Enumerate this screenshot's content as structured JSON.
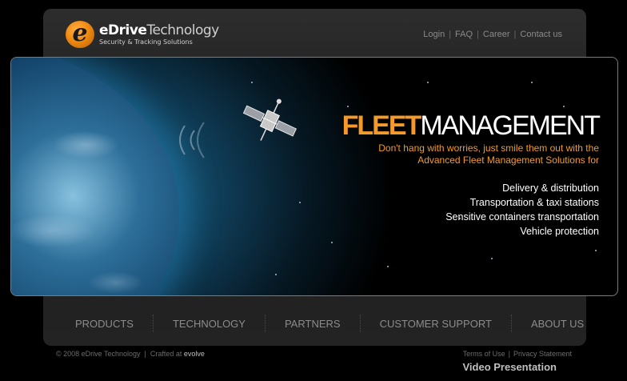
{
  "brand": {
    "logo_letter": "e",
    "name_bold": "eDrive",
    "name_rest": "Technology",
    "tagline": "Security & Tracking Solutions",
    "accent_color": "#f39a28"
  },
  "topnav": {
    "items": [
      "Login",
      "FAQ",
      "Career",
      "Contact us"
    ],
    "separator": "|"
  },
  "banner": {
    "headline_part1": "FLEET",
    "headline_part2": "MANAGEMENT",
    "tagline_line1": "Don't hang with worries, just smile them out with the",
    "tagline_line2": "Advanced Fleet Management Solutions for",
    "features": [
      "Delivery & distribution",
      "Transportation & taxi stations",
      "Sensitive containers transportation",
      "Vehicle protection"
    ]
  },
  "mainnav": {
    "items": [
      "PRODUCTS",
      "TECHNOLOGY",
      "PARTNERS",
      "CUSTOMER SUPPORT",
      "ABOUT US"
    ]
  },
  "footer": {
    "copyright": "© 2008 eDrive Technology",
    "separator": "|",
    "crafted_prefix": "Crafted at",
    "crafted_by": "evolve",
    "terms": "Terms of Use",
    "privacy": "Privacy Statement",
    "video": "Video Presentation"
  }
}
